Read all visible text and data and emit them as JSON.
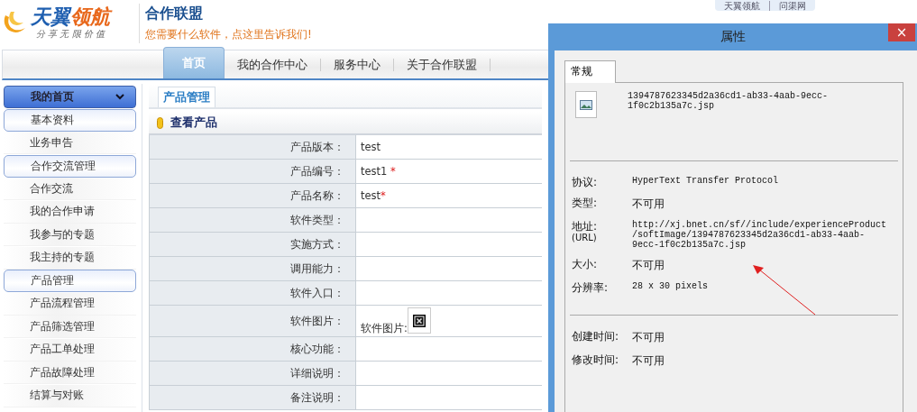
{
  "logo": {
    "words": [
      "天翼",
      "领航"
    ],
    "tagline": "分 享 无 限 价 值"
  },
  "header": {
    "title": "合作联盟",
    "subtitle": "您需要什么软件，点这里告诉我们!"
  },
  "top_links": [
    "天翼领航",
    "问渠网"
  ],
  "nav": [
    {
      "label": "首页",
      "selected": true
    },
    {
      "label": "我的合作中心",
      "selected": false
    },
    {
      "label": "服务中心",
      "selected": false
    },
    {
      "label": "关于合作联盟",
      "selected": false
    }
  ],
  "sidebar": [
    {
      "kind": "header",
      "label": "我的首页"
    },
    {
      "kind": "group",
      "label": "基本资料"
    },
    {
      "kind": "link",
      "label": "业务申告"
    },
    {
      "kind": "group",
      "label": "合作交流管理"
    },
    {
      "kind": "link",
      "label": "合作交流"
    },
    {
      "kind": "link",
      "label": "我的合作申请"
    },
    {
      "kind": "link",
      "label": "我参与的专题"
    },
    {
      "kind": "link",
      "label": "我主持的专题"
    },
    {
      "kind": "group",
      "label": "产品管理"
    },
    {
      "kind": "link",
      "label": "产品流程管理"
    },
    {
      "kind": "link",
      "label": "产品筛选管理"
    },
    {
      "kind": "link",
      "label": "产品工单处理"
    },
    {
      "kind": "link",
      "label": "产品故障处理"
    },
    {
      "kind": "link",
      "label": "结算与对账"
    }
  ],
  "panel": {
    "tab": "产品管理",
    "section": "查看产品",
    "rows": [
      {
        "label": "产品版本：",
        "kind": "text",
        "value": "test"
      },
      {
        "label": "产品编号：",
        "kind": "text",
        "value": "test1",
        "mark": " *"
      },
      {
        "label": "产品名称：",
        "kind": "text",
        "value": "test",
        "mark": "*"
      },
      {
        "label": "软件类型：",
        "kind": "empty"
      },
      {
        "label": "实施方式：",
        "kind": "empty"
      },
      {
        "label": "调用能力：",
        "kind": "empty"
      },
      {
        "label": "软件入口：",
        "kind": "empty"
      },
      {
        "label": "软件图片：",
        "kind": "image",
        "value": "软件图片:"
      },
      {
        "label": "核心功能：",
        "kind": "empty"
      },
      {
        "label": "详细说明：",
        "kind": "empty"
      },
      {
        "label": "备注说明：",
        "kind": "empty"
      }
    ]
  },
  "dialog": {
    "title": "属性",
    "close": "×",
    "tab": "常规",
    "file_name": [
      "1394787623345d2a36cd1-ab33-4aab-9ecc-",
      "1f0c2b135a7c.jsp"
    ],
    "groups": [
      {
        "fields": [
          {
            "label": "协议:",
            "value": [
              "HyperText Transfer Protocol"
            ],
            "mono": true
          },
          {
            "label": "类型:",
            "value": [
              "不可用"
            ],
            "mono": false
          },
          {
            "label": "地址:",
            "sublabel": "(URL)",
            "value": [
              "http://xj.bnet.cn/sf//include/experienceProduct",
              "/softImage/1394787623345d2a36cd1-ab33-4aab-",
              "9ecc-1f0c2b135a7c.jsp"
            ],
            "mono": true
          },
          {
            "label": "大小:",
            "value": [
              "不可用"
            ],
            "mono": false
          },
          {
            "label": "分辨率:",
            "value": [
              "28  x  30  pixels"
            ],
            "mono": true
          }
        ]
      },
      {
        "fields": [
          {
            "label": "创建时间:",
            "value": [
              "不可用"
            ],
            "mono": false
          },
          {
            "label": "修改时间:",
            "value": [
              "不可用"
            ],
            "mono": false
          }
        ]
      }
    ]
  }
}
